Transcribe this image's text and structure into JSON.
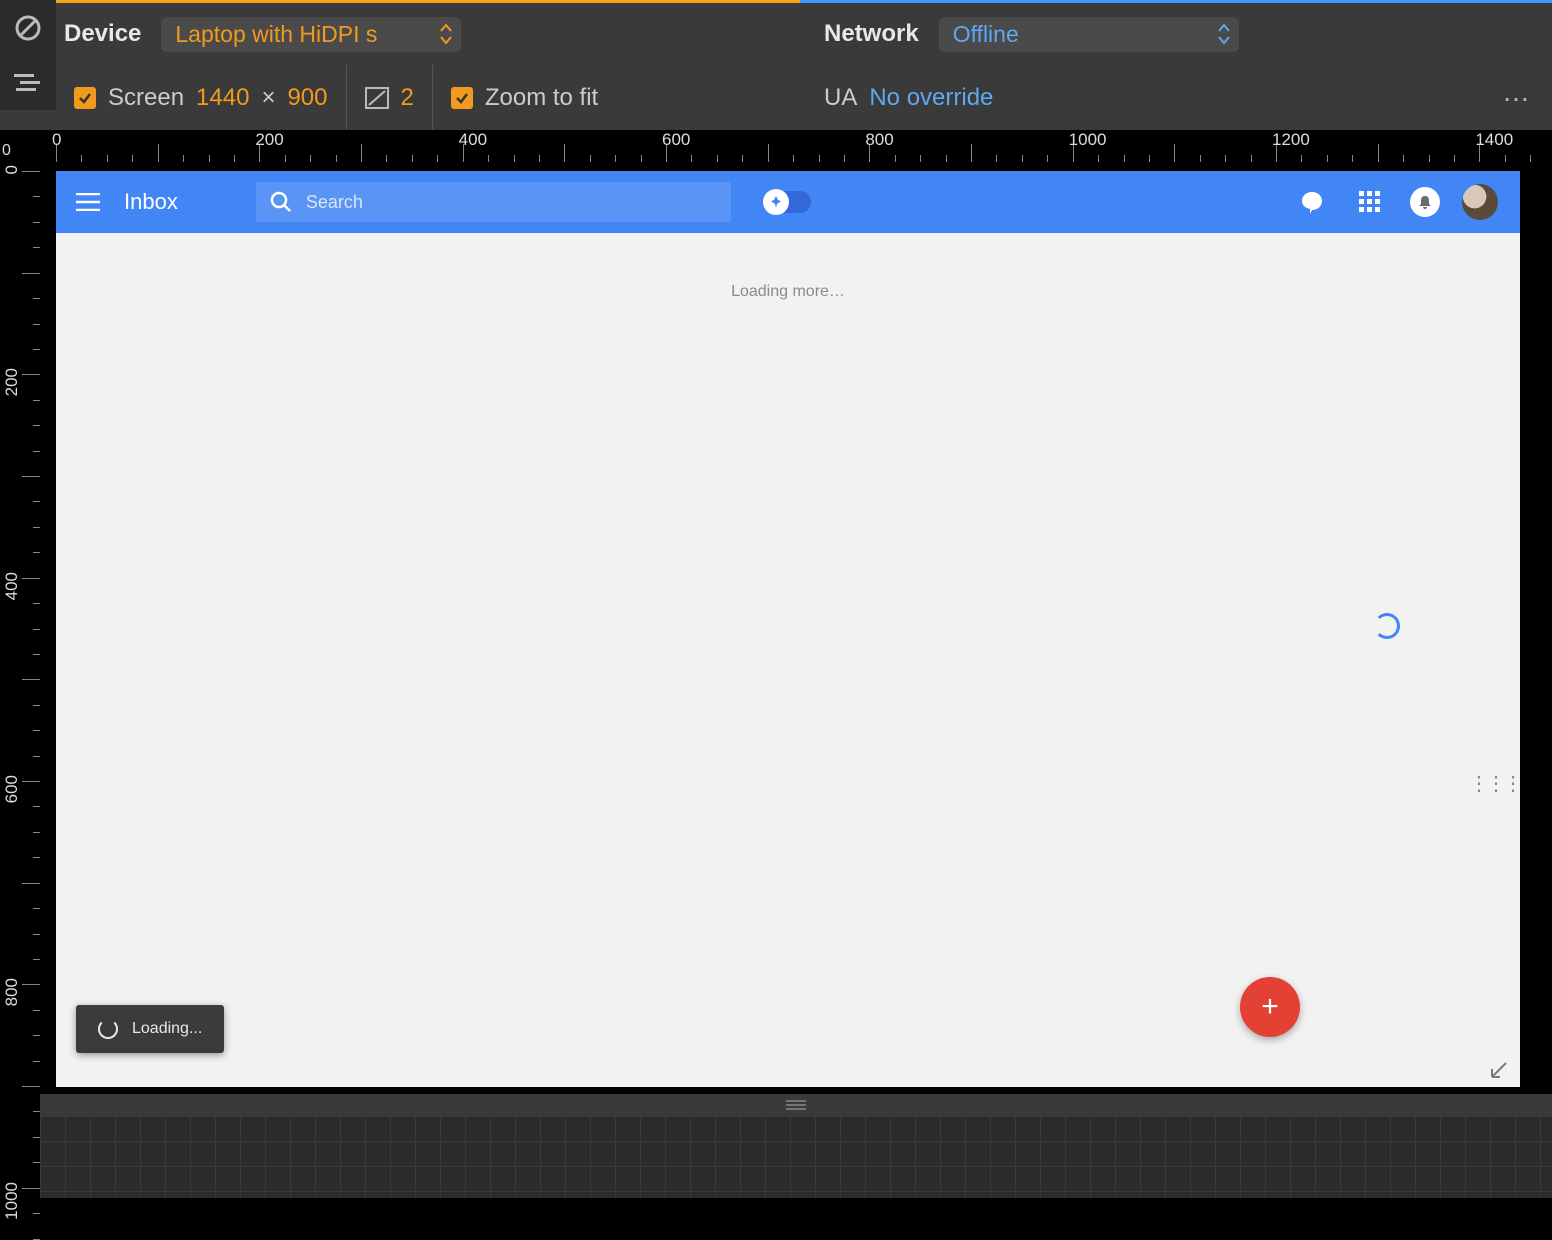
{
  "devtools": {
    "device_label": "Device",
    "device_value": "Laptop with HiDPI s",
    "network_label": "Network",
    "network_value": "Offline",
    "screen_label": "Screen",
    "width": "1440",
    "times": "×",
    "height": "900",
    "dpr": "2",
    "zoom_label": "Zoom to fit",
    "ua_label": "UA",
    "ua_value": "No override",
    "overflow": "…",
    "ruler_origin": "0"
  },
  "ruler_h_labels": [
    "0",
    "200",
    "400",
    "600",
    "800",
    "1000",
    "1200",
    "1400"
  ],
  "ruler_v_labels": [
    "0",
    "200",
    "400",
    "600",
    "800",
    "1000"
  ],
  "inbox": {
    "title": "Inbox",
    "search_placeholder": "Search",
    "loading_more": "Loading more…",
    "toast": "Loading..."
  },
  "icons": {
    "compose": "+"
  }
}
